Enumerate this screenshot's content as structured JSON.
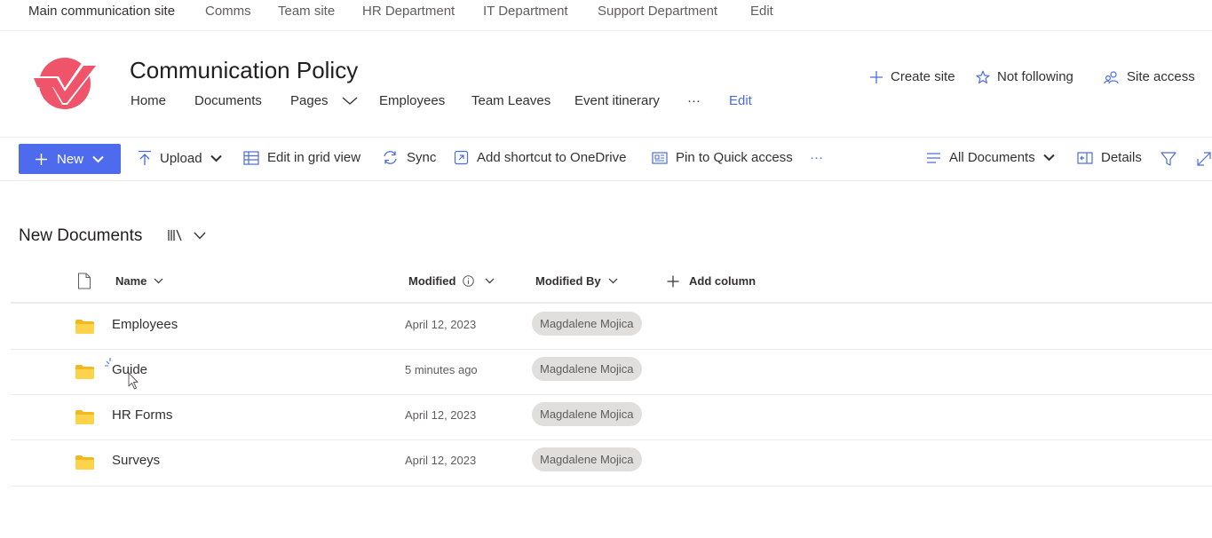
{
  "hub_nav": {
    "items": [
      {
        "label": "Main communication site"
      },
      {
        "label": "Comms"
      },
      {
        "label": "Team site"
      },
      {
        "label": "HR Department"
      },
      {
        "label": "IT Department"
      },
      {
        "label": "Support Department"
      },
      {
        "label": "Edit"
      }
    ]
  },
  "site": {
    "title": "Communication Policy",
    "nav": [
      {
        "label": "Home"
      },
      {
        "label": "Documents"
      },
      {
        "label": "Pages"
      },
      {
        "label": "Employees"
      },
      {
        "label": "Team Leaves"
      },
      {
        "label": "Event itinerary"
      },
      {
        "label": "···"
      },
      {
        "label": "Edit"
      }
    ],
    "actions": {
      "create_site": "Create site",
      "following": "Not following",
      "site_access": "Site access"
    },
    "logo_color": "#f0546a"
  },
  "command_bar": {
    "new": "New",
    "upload": "Upload",
    "edit_grid": "Edit in grid view",
    "sync": "Sync",
    "add_shortcut": "Add shortcut to OneDrive",
    "pin": "Pin to Quick access",
    "more": "···",
    "view": "All Documents",
    "details": "Details"
  },
  "library": {
    "title": "New Documents",
    "columns": {
      "name": "Name",
      "modified": "Modified",
      "modified_by": "Modified By",
      "add_column": "Add column"
    },
    "rows": [
      {
        "name": "Employees",
        "modified": "April 12, 2023",
        "modified_by": "Magdalene Mojica"
      },
      {
        "name": "Guide",
        "modified": "5 minutes ago",
        "modified_by": "Magdalene Mojica"
      },
      {
        "name": "HR Forms",
        "modified": "April 12, 2023",
        "modified_by": "Magdalene Mojica"
      },
      {
        "name": "Surveys",
        "modified": "April 12, 2023",
        "modified_by": "Magdalene Mojica"
      }
    ]
  },
  "colors": {
    "accent": "#4f6bed",
    "link": "#4b6cdb",
    "folder": "#f2c94c"
  }
}
